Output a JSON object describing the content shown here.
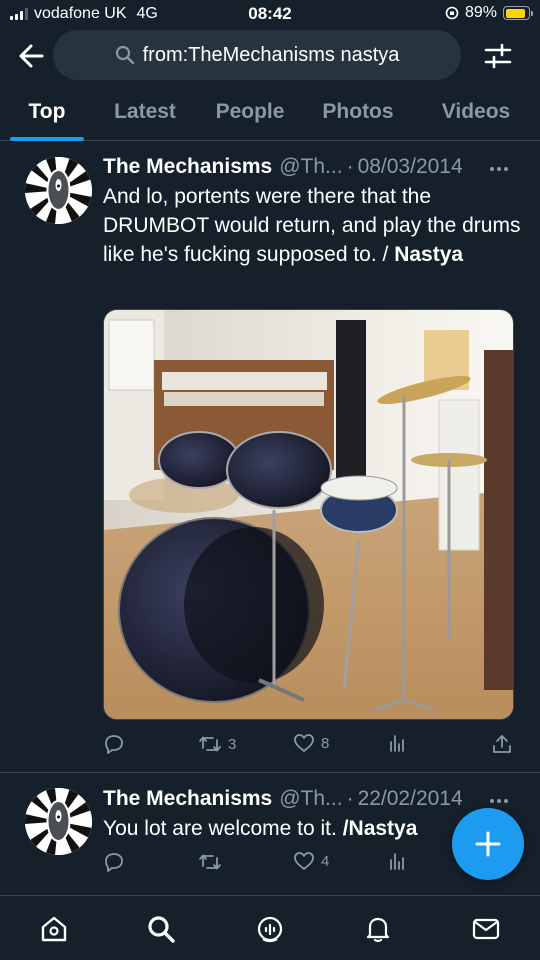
{
  "status_bar": {
    "carrier": "vodafone UK",
    "network": "4G",
    "time": "08:42",
    "battery": "89%",
    "battery_level": 0.89
  },
  "search": {
    "query": "from:TheMechanisms nastya"
  },
  "tabs": [
    {
      "label": "Top",
      "active": true
    },
    {
      "label": "Latest",
      "active": false
    },
    {
      "label": "People",
      "active": false
    },
    {
      "label": "Photos",
      "active": false
    },
    {
      "label": "Videos",
      "active": false
    }
  ],
  "tweets": [
    {
      "author": "The Mechanisms",
      "handle": "@Th...",
      "separator": "·",
      "date": "08/03/2014",
      "text": "And lo, portents were there that the DRUMBOT would return, and play the drums like he's fucking supposed to. /",
      "text_bold": "Nastya",
      "retweets": "3",
      "likes": "8",
      "media": "drum-kit-photo"
    },
    {
      "author": "The Mechanisms",
      "handle": "@Th...",
      "separator": "·",
      "date": "22/02/2014",
      "text": "You lot are welcome to it. ",
      "text_bold": "/Nastya",
      "retweets": "",
      "likes": "4"
    }
  ],
  "bottom_nav": [
    "home-icon",
    "search-icon",
    "spaces-icon",
    "notifications-icon",
    "messages-icon"
  ],
  "colors": {
    "background": "#15202b",
    "accent": "#1d9bf0",
    "secondary_text": "#8b98a5",
    "divider": "#38444d"
  }
}
